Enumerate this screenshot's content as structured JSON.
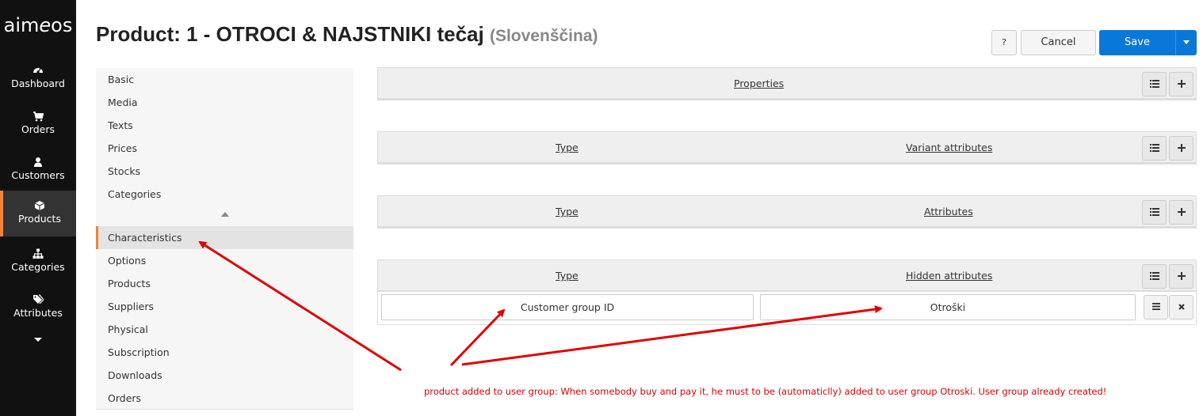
{
  "brand": {
    "logo_a": "aim",
    "logo_e": "e",
    "logo_b": "os"
  },
  "nav": {
    "items": [
      {
        "label": "Dashboard",
        "icon": "dashboard-icon"
      },
      {
        "label": "Orders",
        "icon": "cart-icon"
      },
      {
        "label": "Customers",
        "icon": "user-icon"
      },
      {
        "label": "Products",
        "icon": "cube-icon",
        "active": true
      },
      {
        "label": "Categories",
        "icon": "sitemap-icon"
      },
      {
        "label": "Attributes",
        "icon": "tags-icon"
      }
    ],
    "more_icon": "caret-down-icon"
  },
  "header": {
    "title": "Product: 1 - OTROCI & NAJSTNIKI tečaj",
    "language": "(Slovenščina)",
    "help_label": "?",
    "cancel_label": "Cancel",
    "save_label": "Save"
  },
  "tabs": {
    "items": [
      "Basic",
      "Media",
      "Texts",
      "Prices",
      "Stocks",
      "Categories"
    ],
    "items_more": [
      "Characteristics",
      "Options",
      "Products",
      "Suppliers",
      "Physical",
      "Subscription",
      "Downloads",
      "Orders"
    ],
    "active": "Characteristics"
  },
  "panels": {
    "properties": {
      "header": "Properties"
    },
    "variant": {
      "type_header": "Type",
      "header": "Variant attributes"
    },
    "attributes": {
      "type_header": "Type",
      "header": "Attributes"
    },
    "hidden": {
      "type_header": "Type",
      "header": "Hidden attributes",
      "row": {
        "type": "Customer group ID",
        "value": "Otroški"
      }
    }
  },
  "annotation": {
    "note": "product added to user group: When somebody buy and pay it, he must to be (automaticlly) added to user group Otroski. User group already created!",
    "color": "#e00000"
  }
}
